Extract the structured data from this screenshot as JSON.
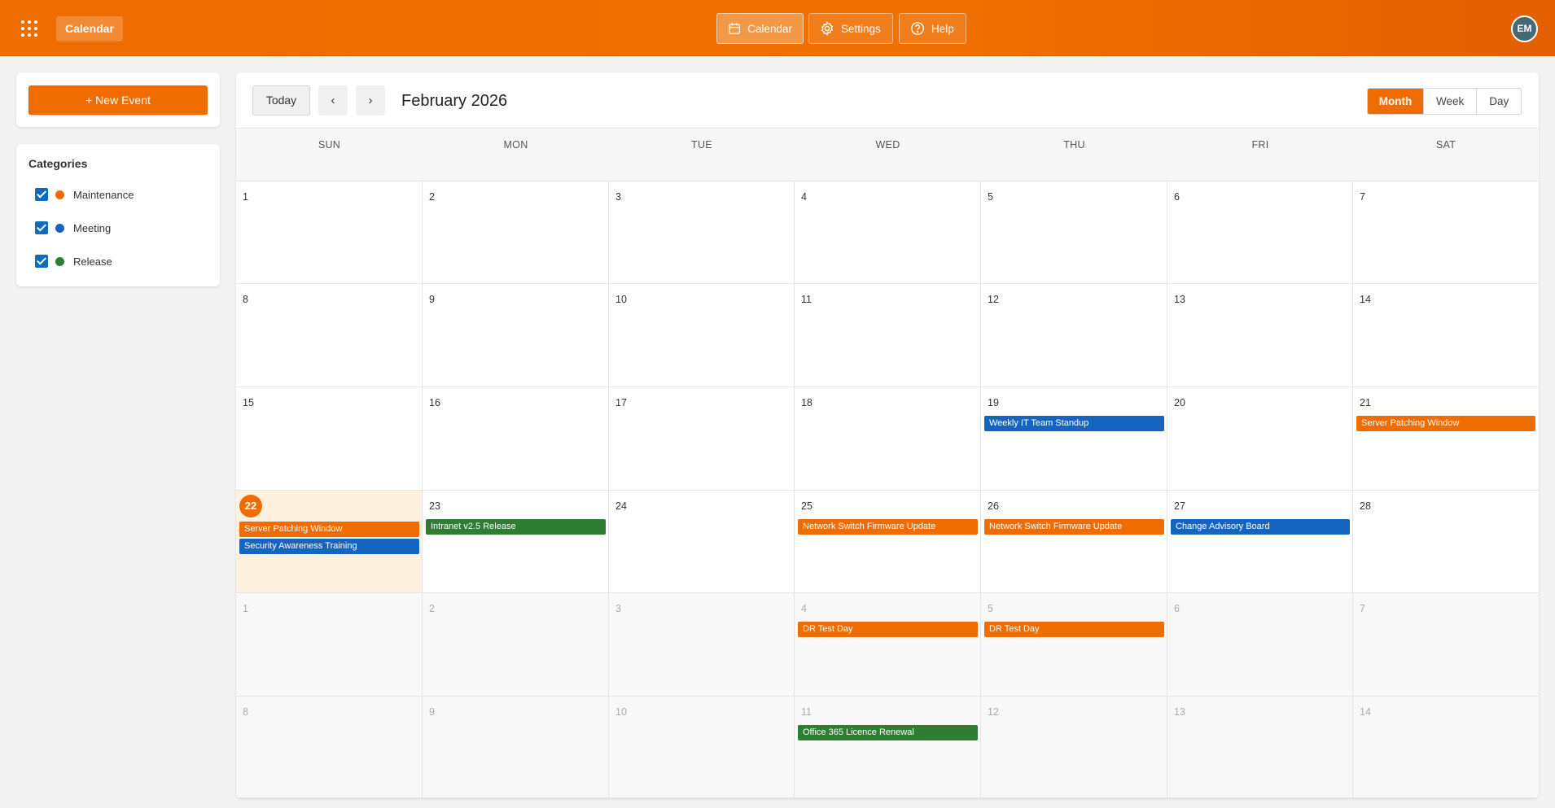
{
  "topbar": {
    "app_name": "Calendar",
    "nav": [
      {
        "label": "Calendar",
        "icon": "calendar-icon",
        "active": true
      },
      {
        "label": "Settings",
        "icon": "gear-icon",
        "active": false
      },
      {
        "label": "Help",
        "icon": "help-icon",
        "active": false
      }
    ],
    "avatar_initials": "EM"
  },
  "sidebar": {
    "new_event_label": "+ New Event",
    "categories_title": "Categories",
    "categories": [
      {
        "label": "Maintenance",
        "color": "#ef6c00",
        "checked": true
      },
      {
        "label": "Meeting",
        "color": "#1565c0",
        "checked": true
      },
      {
        "label": "Release",
        "color": "#2e7d32",
        "checked": true
      }
    ]
  },
  "calendar": {
    "today_label": "Today",
    "prev_label": "‹",
    "next_label": "›",
    "title": "February 2026",
    "views": [
      {
        "label": "Month",
        "active": true
      },
      {
        "label": "Week",
        "active": false
      },
      {
        "label": "Day",
        "active": false
      }
    ],
    "weekdays": [
      "SUN",
      "MON",
      "TUE",
      "WED",
      "THU",
      "FRI",
      "SAT"
    ],
    "weeks": [
      [
        {
          "day": "1"
        },
        {
          "day": "2"
        },
        {
          "day": "3"
        },
        {
          "day": "4"
        },
        {
          "day": "5"
        },
        {
          "day": "6"
        },
        {
          "day": "7"
        }
      ],
      [
        {
          "day": "8"
        },
        {
          "day": "9"
        },
        {
          "day": "10"
        },
        {
          "day": "11"
        },
        {
          "day": "12"
        },
        {
          "day": "13"
        },
        {
          "day": "14"
        }
      ],
      [
        {
          "day": "15"
        },
        {
          "day": "16"
        },
        {
          "day": "17"
        },
        {
          "day": "18"
        },
        {
          "day": "19",
          "events": [
            {
              "title": "Weekly IT Team Standup",
              "category": "Meeting"
            }
          ]
        },
        {
          "day": "20"
        },
        {
          "day": "21",
          "events": [
            {
              "title": "Server Patching Window",
              "category": "Maintenance"
            }
          ]
        }
      ],
      [
        {
          "day": "22",
          "today": true,
          "events": [
            {
              "title": "Server Patching Window",
              "category": "Maintenance"
            },
            {
              "title": "Security Awareness Training",
              "category": "Meeting"
            }
          ]
        },
        {
          "day": "23",
          "events": [
            {
              "title": "Intranet v2.5 Release",
              "category": "Release"
            }
          ]
        },
        {
          "day": "24"
        },
        {
          "day": "25",
          "events": [
            {
              "title": "Network Switch Firmware Update",
              "category": "Maintenance"
            }
          ]
        },
        {
          "day": "26",
          "events": [
            {
              "title": "Network Switch Firmware Update",
              "category": "Maintenance"
            }
          ]
        },
        {
          "day": "27",
          "events": [
            {
              "title": "Change Advisory Board",
              "category": "Meeting"
            }
          ]
        },
        {
          "day": "28"
        }
      ],
      [
        {
          "day": "1",
          "other": true
        },
        {
          "day": "2",
          "other": true
        },
        {
          "day": "3",
          "other": true
        },
        {
          "day": "4",
          "other": true,
          "events": [
            {
              "title": "DR Test Day",
              "category": "Maintenance"
            }
          ]
        },
        {
          "day": "5",
          "other": true,
          "events": [
            {
              "title": "DR Test Day",
              "category": "Maintenance"
            }
          ]
        },
        {
          "day": "6",
          "other": true
        },
        {
          "day": "7",
          "other": true
        }
      ],
      [
        {
          "day": "8",
          "other": true
        },
        {
          "day": "9",
          "other": true
        },
        {
          "day": "10",
          "other": true
        },
        {
          "day": "11",
          "other": true,
          "events": [
            {
              "title": "Office 365 Licence Renewal",
              "category": "Release"
            }
          ]
        },
        {
          "day": "12",
          "other": true
        },
        {
          "day": "13",
          "other": true
        },
        {
          "day": "14",
          "other": true
        }
      ]
    ]
  },
  "colors": {
    "Maintenance": "#ef6c00",
    "Meeting": "#1565c0",
    "Release": "#2e7d32",
    "accent": "#ef6c00"
  }
}
